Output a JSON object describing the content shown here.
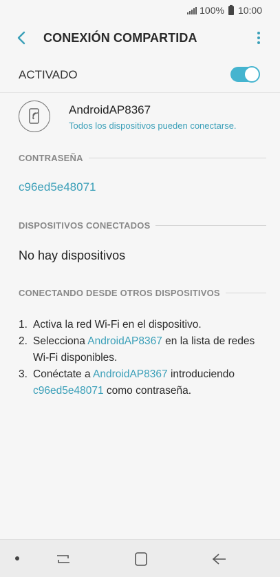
{
  "status_bar": {
    "battery_text": "100%",
    "time": "10:00"
  },
  "app_bar": {
    "title": "CONEXIÓN COMPARTIDA"
  },
  "hotspot": {
    "label": "ACTIVADO",
    "enabled": true
  },
  "network": {
    "name": "AndroidAP8367",
    "subtitle": "Todos los dispositivos pueden conectarse."
  },
  "password_section": {
    "header": "CONTRASEÑA",
    "value": "c96ed5e48071"
  },
  "devices_section": {
    "header": "DISPOSITIVOS CONECTADOS",
    "empty_text": "No hay dispositivos"
  },
  "instructions_section": {
    "header": "CONECTANDO DESDE OTROS DISPOSITIVOS",
    "step1": {
      "num": "1.",
      "text": "Activa la red Wi-Fi en el dispositivo."
    },
    "step2": {
      "num": "2.",
      "before": "Selecciona ",
      "link": "AndroidAP8367",
      "after": " en la lista de redes Wi-Fi disponibles."
    },
    "step3": {
      "num": "3.",
      "before": "Conéctate a ",
      "link1": "AndroidAP8367",
      "middle": " introduciendo ",
      "link2": "c96ed5e48071",
      "after": " como contraseña."
    }
  },
  "colors": {
    "accent": "#3a9fb8",
    "toggle_on": "#45b4cf",
    "background": "#f6f6f6"
  }
}
